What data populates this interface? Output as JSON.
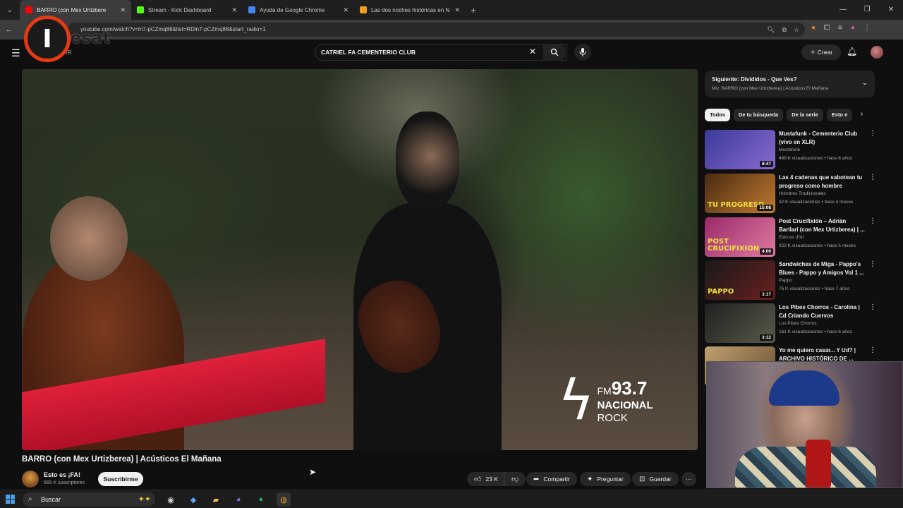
{
  "browser": {
    "tabs": [
      {
        "label": "BARRO (con Mex Urtizbere",
        "favicon_color": "#ff0000",
        "active": true
      },
      {
        "label": "Stream - Kick Dashboard",
        "favicon_color": "#53fc18",
        "active": false
      },
      {
        "label": "Ayuda de Google Chrome",
        "favicon_color": "#4285f4",
        "active": false
      },
      {
        "label": "Las dos noches históricas en N",
        "favicon_color": "#f0a020",
        "active": false
      }
    ],
    "url": "youtube.com/watch?v=ln7-pCZmq88&list=RDln7-pCZmq88&start_radio=1"
  },
  "overlay_logo": {
    "letter": "I",
    "text": "esat"
  },
  "youtube": {
    "brand_sub": "AR",
    "search_value": "CATRIEL FA CEMENTERIO CLUB",
    "create_label": "Crear"
  },
  "video": {
    "title": "BARRO (con Mex Urtizberea) | Acústicos El Mañana",
    "watermark": {
      "band": "FM",
      "freq": "93.7",
      "name1": "NACIONAL",
      "name2": "ROCK"
    },
    "channel": "Esto es ¡FA!",
    "subscribers": "665 K suscriptores",
    "subscribe_label": "Suscribirme",
    "likes": "23 K",
    "share_label": "Compartir",
    "ask_label": "Preguntar",
    "save_label": "Guardar"
  },
  "sidebar": {
    "next_title": "Siguiente: Divididos - Que Ves?",
    "next_sub": "Mix: BARRO (con Mex Urtizberea) | Acústicos El Mañana",
    "chips": [
      "Todos",
      "De tu búsqueda",
      "De la serie",
      "Esto e"
    ],
    "recommendations": [
      {
        "title": "Mustafunk - Cementerio Club (vivo en XLR)",
        "channel": "Mustafunk",
        "meta": "469 K visualizaciones • hace 8 años",
        "duration": "8:47",
        "thumb_text": "",
        "colors": [
          "#3a3a9a",
          "#8a6ad0"
        ]
      },
      {
        "title": "Las 4 cadenas que sabotean tu progreso como hombre",
        "channel": "Hombres Tradicionales",
        "meta": "32 K visualizaciones • hace 4 meses",
        "duration": "15:08",
        "thumb_text": "TU PROGRESO",
        "colors": [
          "#4a2a10",
          "#c07a30"
        ]
      },
      {
        "title": "Post Crucifixión – Adrián Barilari (con Mex Urtizberea) | ...",
        "channel": "Esto es ¡FA!",
        "meta": "322 K visualizaciones • hace 5 meses",
        "duration": "4:06",
        "thumb_text": "POST CRUCIFIXION",
        "colors": [
          "#9a2a6a",
          "#e07aa0"
        ]
      },
      {
        "title": "Sandwiches de Miga - Pappo's Blues - Pappo y Amigos Vol 1 ...",
        "channel": "Pappo",
        "meta": "76 K visualizaciones • hace 7 años",
        "duration": "3:17",
        "thumb_text": "PAPPO",
        "colors": [
          "#1a1a1a",
          "#6a2020"
        ]
      },
      {
        "title": "Los Pibes Chorros - Carolina | Cd Criando Cuervos",
        "channel": "Los Pibes Chorros",
        "meta": "161 K visualizaciones • hace 6 años",
        "duration": "3:12",
        "thumb_text": "",
        "colors": [
          "#202020",
          "#5a5a4a"
        ]
      },
      {
        "title": "Yo me quiero casar... Y Ud? | ARCHIVO HISTÓRICO DE ...",
        "channel": "",
        "meta": "",
        "duration": "",
        "thumb_text": "",
        "colors": [
          "#c0a070",
          "#6a5030"
        ]
      }
    ]
  },
  "taskbar": {
    "search_placeholder": "Buscar"
  }
}
